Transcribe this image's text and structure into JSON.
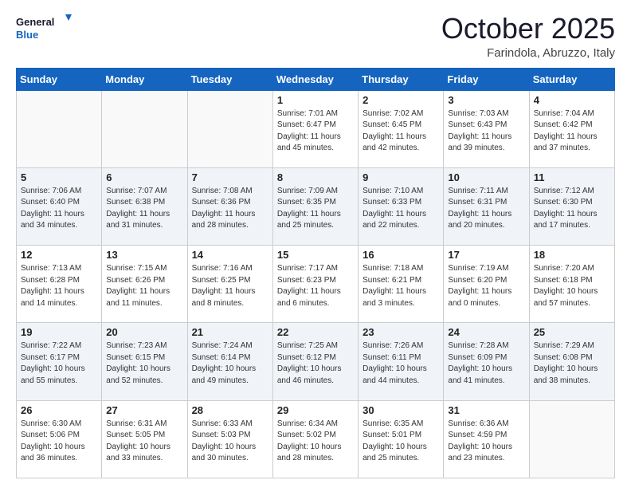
{
  "header": {
    "logo_general": "General",
    "logo_blue": "Blue",
    "month": "October 2025",
    "location": "Farindola, Abruzzo, Italy"
  },
  "weekdays": [
    "Sunday",
    "Monday",
    "Tuesday",
    "Wednesday",
    "Thursday",
    "Friday",
    "Saturday"
  ],
  "weeks": [
    [
      {
        "day": "",
        "info": ""
      },
      {
        "day": "",
        "info": ""
      },
      {
        "day": "",
        "info": ""
      },
      {
        "day": "1",
        "info": "Sunrise: 7:01 AM\nSunset: 6:47 PM\nDaylight: 11 hours and 45 minutes."
      },
      {
        "day": "2",
        "info": "Sunrise: 7:02 AM\nSunset: 6:45 PM\nDaylight: 11 hours and 42 minutes."
      },
      {
        "day": "3",
        "info": "Sunrise: 7:03 AM\nSunset: 6:43 PM\nDaylight: 11 hours and 39 minutes."
      },
      {
        "day": "4",
        "info": "Sunrise: 7:04 AM\nSunset: 6:42 PM\nDaylight: 11 hours and 37 minutes."
      }
    ],
    [
      {
        "day": "5",
        "info": "Sunrise: 7:06 AM\nSunset: 6:40 PM\nDaylight: 11 hours and 34 minutes."
      },
      {
        "day": "6",
        "info": "Sunrise: 7:07 AM\nSunset: 6:38 PM\nDaylight: 11 hours and 31 minutes."
      },
      {
        "day": "7",
        "info": "Sunrise: 7:08 AM\nSunset: 6:36 PM\nDaylight: 11 hours and 28 minutes."
      },
      {
        "day": "8",
        "info": "Sunrise: 7:09 AM\nSunset: 6:35 PM\nDaylight: 11 hours and 25 minutes."
      },
      {
        "day": "9",
        "info": "Sunrise: 7:10 AM\nSunset: 6:33 PM\nDaylight: 11 hours and 22 minutes."
      },
      {
        "day": "10",
        "info": "Sunrise: 7:11 AM\nSunset: 6:31 PM\nDaylight: 11 hours and 20 minutes."
      },
      {
        "day": "11",
        "info": "Sunrise: 7:12 AM\nSunset: 6:30 PM\nDaylight: 11 hours and 17 minutes."
      }
    ],
    [
      {
        "day": "12",
        "info": "Sunrise: 7:13 AM\nSunset: 6:28 PM\nDaylight: 11 hours and 14 minutes."
      },
      {
        "day": "13",
        "info": "Sunrise: 7:15 AM\nSunset: 6:26 PM\nDaylight: 11 hours and 11 minutes."
      },
      {
        "day": "14",
        "info": "Sunrise: 7:16 AM\nSunset: 6:25 PM\nDaylight: 11 hours and 8 minutes."
      },
      {
        "day": "15",
        "info": "Sunrise: 7:17 AM\nSunset: 6:23 PM\nDaylight: 11 hours and 6 minutes."
      },
      {
        "day": "16",
        "info": "Sunrise: 7:18 AM\nSunset: 6:21 PM\nDaylight: 11 hours and 3 minutes."
      },
      {
        "day": "17",
        "info": "Sunrise: 7:19 AM\nSunset: 6:20 PM\nDaylight: 11 hours and 0 minutes."
      },
      {
        "day": "18",
        "info": "Sunrise: 7:20 AM\nSunset: 6:18 PM\nDaylight: 10 hours and 57 minutes."
      }
    ],
    [
      {
        "day": "19",
        "info": "Sunrise: 7:22 AM\nSunset: 6:17 PM\nDaylight: 10 hours and 55 minutes."
      },
      {
        "day": "20",
        "info": "Sunrise: 7:23 AM\nSunset: 6:15 PM\nDaylight: 10 hours and 52 minutes."
      },
      {
        "day": "21",
        "info": "Sunrise: 7:24 AM\nSunset: 6:14 PM\nDaylight: 10 hours and 49 minutes."
      },
      {
        "day": "22",
        "info": "Sunrise: 7:25 AM\nSunset: 6:12 PM\nDaylight: 10 hours and 46 minutes."
      },
      {
        "day": "23",
        "info": "Sunrise: 7:26 AM\nSunset: 6:11 PM\nDaylight: 10 hours and 44 minutes."
      },
      {
        "day": "24",
        "info": "Sunrise: 7:28 AM\nSunset: 6:09 PM\nDaylight: 10 hours and 41 minutes."
      },
      {
        "day": "25",
        "info": "Sunrise: 7:29 AM\nSunset: 6:08 PM\nDaylight: 10 hours and 38 minutes."
      }
    ],
    [
      {
        "day": "26",
        "info": "Sunrise: 6:30 AM\nSunset: 5:06 PM\nDaylight: 10 hours and 36 minutes."
      },
      {
        "day": "27",
        "info": "Sunrise: 6:31 AM\nSunset: 5:05 PM\nDaylight: 10 hours and 33 minutes."
      },
      {
        "day": "28",
        "info": "Sunrise: 6:33 AM\nSunset: 5:03 PM\nDaylight: 10 hours and 30 minutes."
      },
      {
        "day": "29",
        "info": "Sunrise: 6:34 AM\nSunset: 5:02 PM\nDaylight: 10 hours and 28 minutes."
      },
      {
        "day": "30",
        "info": "Sunrise: 6:35 AM\nSunset: 5:01 PM\nDaylight: 10 hours and 25 minutes."
      },
      {
        "day": "31",
        "info": "Sunrise: 6:36 AM\nSunset: 4:59 PM\nDaylight: 10 hours and 23 minutes."
      },
      {
        "day": "",
        "info": ""
      }
    ]
  ]
}
